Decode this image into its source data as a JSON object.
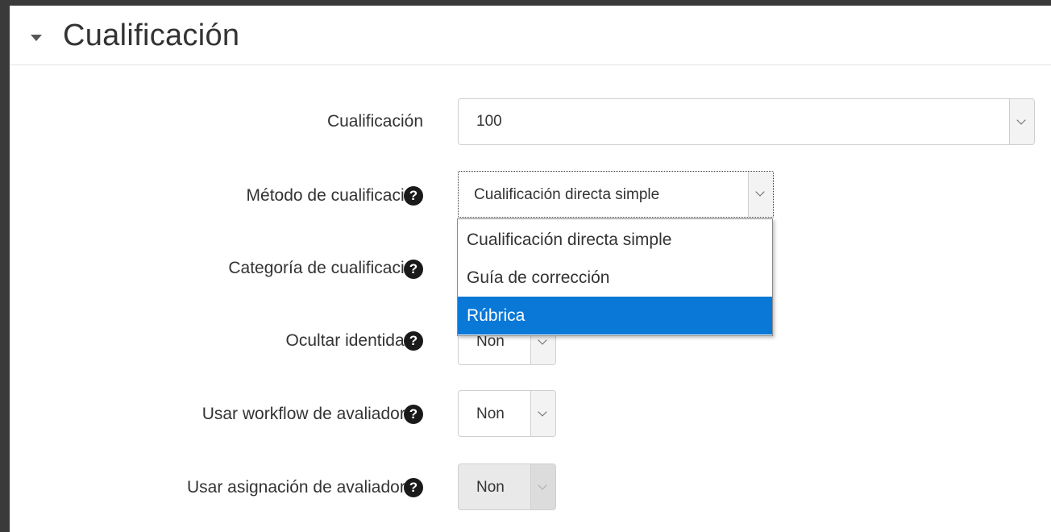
{
  "section": {
    "title": "Cualificación"
  },
  "fields": {
    "cualificacion": {
      "label": "Cualificación",
      "value": "100"
    },
    "metodo": {
      "label": "Método de cualificación",
      "value": "Cualificación directa simple"
    },
    "categoria": {
      "label": "Categoría de cualificación"
    },
    "ocultar": {
      "label": "Ocultar identidade",
      "value": "Non"
    },
    "workflow": {
      "label": "Usar workflow de avaliadores",
      "value": "Non"
    },
    "asignacion": {
      "label": "Usar asignación de avaliadores",
      "value": "Non"
    }
  },
  "dropdown": {
    "options": [
      "Cualificación directa simple",
      "Guía de corrección",
      "Rúbrica"
    ],
    "highlighted": "Rúbrica"
  },
  "help_symbol": "?",
  "colors": {
    "highlight": "#0a78d7",
    "background": "#3a3a3a"
  }
}
